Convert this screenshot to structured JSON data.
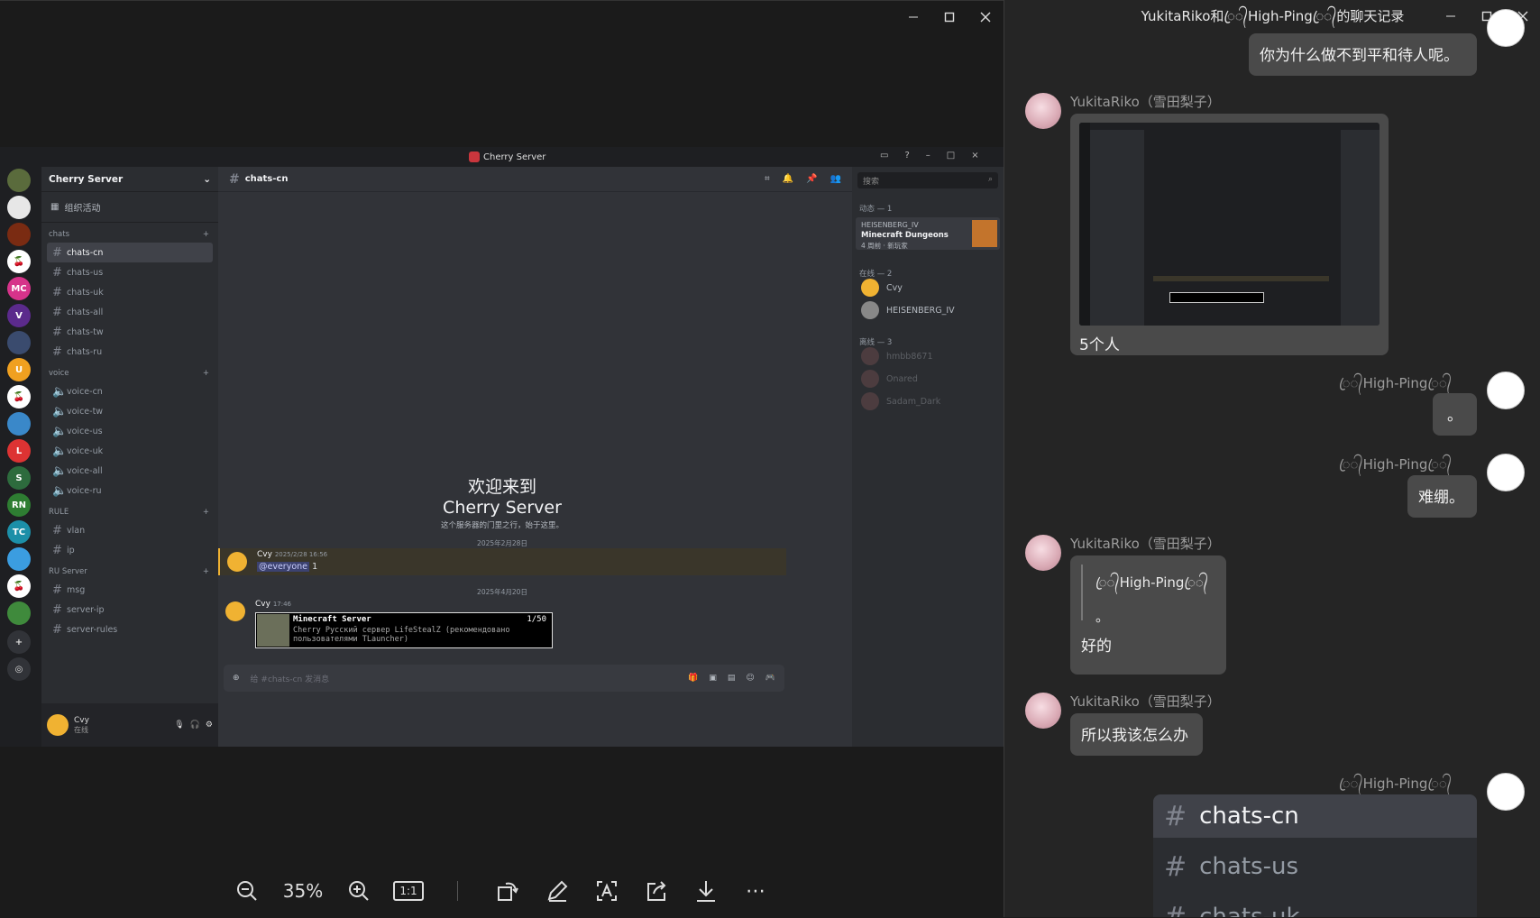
{
  "viewer": {
    "zoom": "35%",
    "toolbar": [
      "zoom-out-icon",
      "zoom-in-icon",
      "actual-size-icon",
      "rotate-icon",
      "edit-icon",
      "ocr-icon",
      "share-icon",
      "download-icon",
      "more-icon"
    ],
    "actual_size_label": "1:1",
    "more_label": "⋯"
  },
  "discord": {
    "window_title": "Cherry Server",
    "server_name": "Cherry Server",
    "events_label": "组织活动",
    "categories": [
      {
        "name": "chats",
        "channels": [
          "chats-cn",
          "chats-us",
          "chats-uk",
          "chats-all",
          "chats-tw",
          "chats-ru"
        ]
      },
      {
        "name": "voice",
        "channels": [
          "voice-cn",
          "voice-tw",
          "voice-us",
          "voice-uk",
          "voice-all",
          "voice-ru"
        ]
      },
      {
        "name": "RULE",
        "channels": [
          "vlan",
          "ip"
        ]
      },
      {
        "name": "RU Server",
        "channels": [
          "msg",
          "server-ip",
          "server-rules"
        ]
      }
    ],
    "active_channel": "chats-cn",
    "user": {
      "name": "Cvy",
      "status": "在线"
    },
    "welcome_title_1": "欢迎来到",
    "welcome_title_2": "Cherry Server",
    "welcome_sub": "这个服务器的门里之行，始于这里。",
    "date1": "2025年2月28日",
    "msg1": {
      "author": "Cvy",
      "time": "2025/2/28 16:56",
      "mention": "@everyone",
      "text": "1"
    },
    "date2": "2025年4月20日",
    "msg2": {
      "author": "Cvy",
      "time": "17:46",
      "embed_title": "Minecraft Server",
      "embed_count": "1/50",
      "embed_desc": "Cherry Русский сервер LifeStealZ (рекомендовано пользователями TLauncher)"
    },
    "input_placeholder": "给 #chats-cn 发消息",
    "search_placeholder": "搜索",
    "members": {
      "activity_header": "动态 — 1",
      "activity_user": "HEISENBERG_IV",
      "activity_game": "Minecraft Dungeons",
      "activity_meta": "4 周前 · 新玩家",
      "online_header": "在线 — 2",
      "online": [
        "Cvy",
        "HEISENBERG_IV"
      ],
      "offline_header": "离线 — 3",
      "offline": [
        "hmbb8671",
        "Onared",
        "Sadam_Dark"
      ]
    }
  },
  "history": {
    "title": "YukitaRiko和ꦿ᭄High-Pingꦿ᭄的聊天记录",
    "messages": [
      {
        "side": "right",
        "text": "你为什么做不到平和待人呢。"
      },
      {
        "side": "left",
        "name": "YukitaRiko（雪田梨子）",
        "image": true,
        "text": "5个人"
      },
      {
        "side": "right",
        "name": "ꦿ᭄High-Pingꦿ᭄",
        "text": "。"
      },
      {
        "side": "right",
        "name": "ꦿ᭄High-Pingꦿ᭄",
        "text": "难绷。"
      },
      {
        "side": "left",
        "name": "YukitaRiko（雪田梨子）",
        "quote_name": "ꦿ᭄High-Pingꦿ᭄",
        "quote_text": "。",
        "text": "好的"
      },
      {
        "side": "left",
        "name": "YukitaRiko（雪田梨子）",
        "text": "所以我该怎么办"
      },
      {
        "side": "right",
        "name": "ꦿ᭄High-Pingꦿ᭄",
        "image_channels": [
          "chats-cn",
          "chats-us",
          "chats-uk"
        ]
      }
    ],
    "window_controls": [
      "minimize-icon",
      "maximize-icon",
      "close-icon"
    ]
  }
}
